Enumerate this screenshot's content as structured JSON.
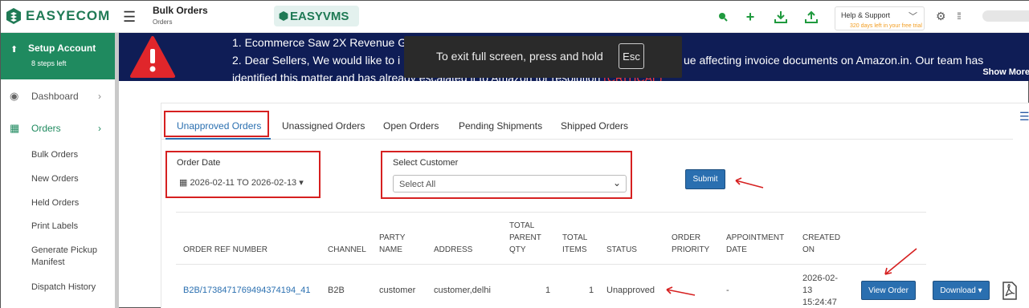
{
  "header": {
    "logo_text": "EASYECOM",
    "page_title": "Bulk Orders",
    "page_subtitle": "Orders",
    "vms_text": "EASYVMS",
    "help_label": "Help & Support",
    "trial_text": "320 days left in your free trial"
  },
  "sidebar": {
    "setup_title": "Setup Account",
    "setup_sub": "8 steps left",
    "items": [
      {
        "label": "Dashboard"
      },
      {
        "label": "Orders"
      }
    ],
    "subitems": [
      {
        "label": "Bulk Orders"
      },
      {
        "label": "New Orders"
      },
      {
        "label": "Held Orders"
      },
      {
        "label": "Print Labels"
      },
      {
        "label": "Generate Pickup Manifest"
      },
      {
        "label": "Dispatch History"
      }
    ]
  },
  "banner": {
    "line1": "1. Ecommerce Saw 2X Revenue G",
    "line2a": "2. Dear Sellers, We would like to i",
    "line2b": "ue affecting invoice documents on Amazon.in. Our team has",
    "line3a": "identified this matter and has already escalated it to Amazon for resolution",
    "line3b": "(CRITICAL)",
    "show_more": "Show More",
    "fullscreen_msg": "To exit full screen, press and hold",
    "fullscreen_key": "Esc"
  },
  "tabs": [
    {
      "label": "Unapproved Orders"
    },
    {
      "label": "Unassigned Orders"
    },
    {
      "label": "Open Orders"
    },
    {
      "label": "Pending Shipments"
    },
    {
      "label": "Shipped Orders"
    }
  ],
  "filters": {
    "order_date_label": "Order Date",
    "order_date_value": "2026-02-11 TO 2026-02-13",
    "customer_label": "Select Customer",
    "customer_value": "Select All",
    "submit_label": "Submit"
  },
  "table": {
    "headers": [
      "ORDER REF NUMBER",
      "CHANNEL",
      "PARTY NAME",
      "ADDRESS",
      "TOTAL PARENT QTY",
      "TOTAL ITEMS",
      "STATUS",
      "ORDER PRIORITY",
      "APPOINTMENT DATE",
      "CREATED ON"
    ],
    "rows": [
      {
        "ref": "B2B/1738471769494374194_41",
        "channel": "B2B",
        "party": "customer",
        "address": "customer,delhi",
        "parent_qty": "1",
        "items": "1",
        "status": "Unapproved",
        "appointment": "-",
        "created": "2026-02-13 15:24:47",
        "view_label": "View Order",
        "download_label": "Download"
      }
    ]
  },
  "colors": {
    "brand_green": "#1f8a5f",
    "primary_blue": "#2a6fb0",
    "banner_navy": "#0f1d56",
    "highlight_red": "#d62020"
  }
}
